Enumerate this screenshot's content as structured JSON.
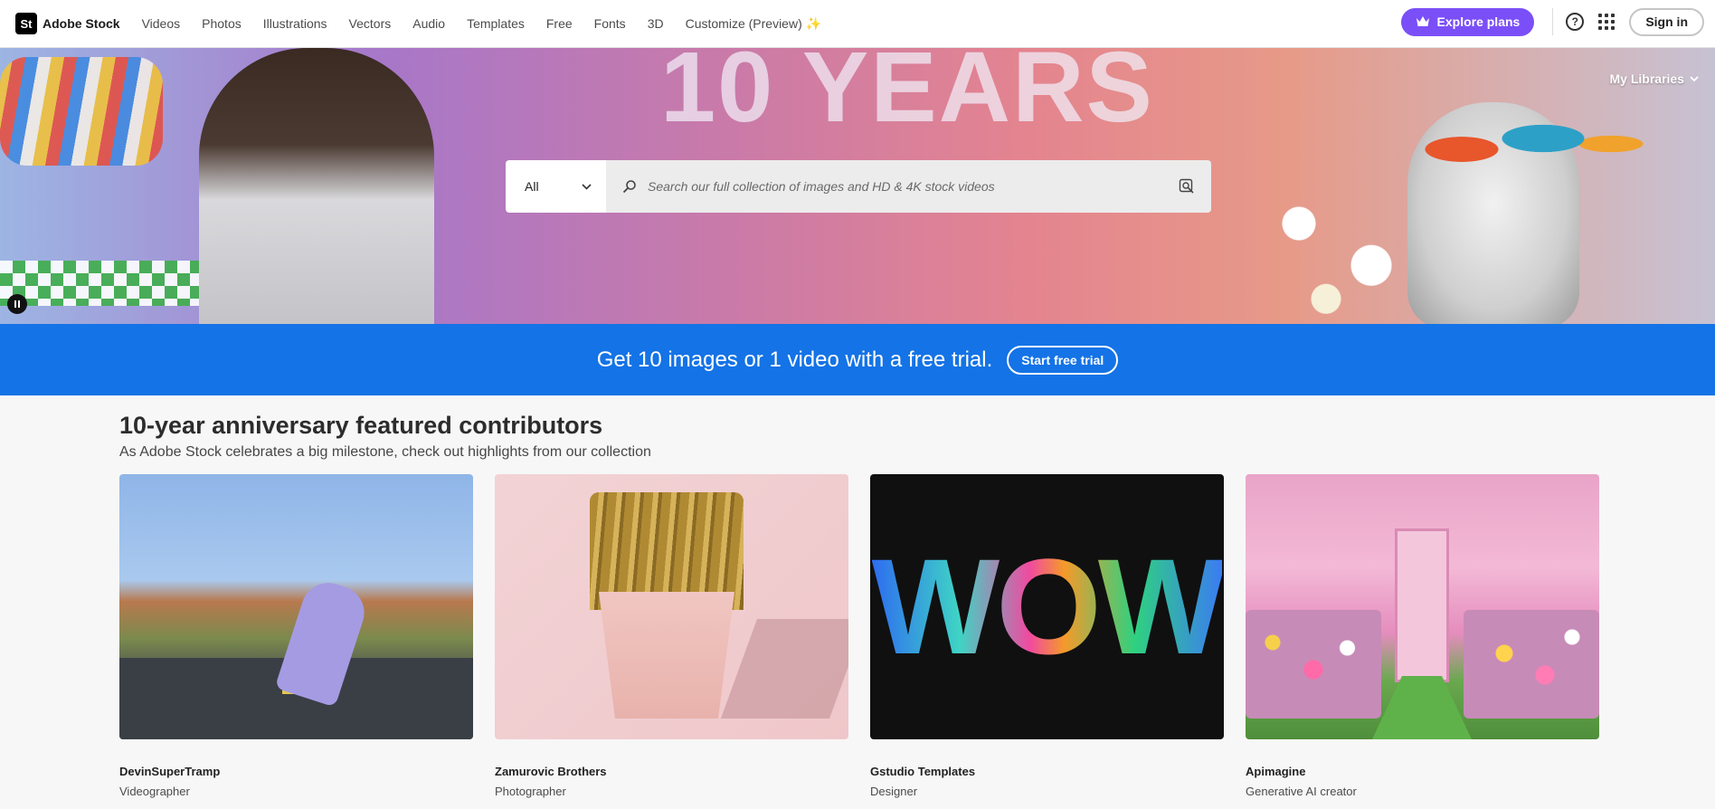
{
  "brand": {
    "logo": "St",
    "name": "Adobe Stock"
  },
  "nav": {
    "items": [
      "Videos",
      "Photos",
      "Illustrations",
      "Vectors",
      "Audio",
      "Templates",
      "Free",
      "Fonts",
      "3D",
      "Customize (Preview) ✨"
    ]
  },
  "header": {
    "explore_label": "Explore plans",
    "explore_icon": "crown-icon",
    "help_icon": "help-icon",
    "apps_icon": "apps-grid-icon",
    "signin_label": "Sign in",
    "accent_color": "#7b4ff7"
  },
  "hero": {
    "banner_text": "10 YEARS",
    "my_libraries_label": "My Libraries",
    "search": {
      "type_value": "All",
      "placeholder": "Search our full collection of images and HD & 4K stock videos",
      "search_icon": "search-icon",
      "visual_search_icon": "visual-search-icon"
    },
    "pause_icon": "pause-icon"
  },
  "promo": {
    "text": "Get 10 images or 1 video with a free trial.",
    "button_label": "Start free trial",
    "color": "#1473e6"
  },
  "featured": {
    "title": "10-year anniversary featured contributors",
    "subtitle": "As Adobe Stock celebrates a big milestone, check out highlights from our collection",
    "cards": [
      {
        "name": "DevinSuperTramp",
        "role": "Videographer"
      },
      {
        "name": "Zamurovic Brothers",
        "role": "Photographer"
      },
      {
        "name": "Gstudio Templates",
        "role": "Designer",
        "image_text": "WOW"
      },
      {
        "name": "Apimagine",
        "role": "Generative AI creator"
      }
    ]
  }
}
